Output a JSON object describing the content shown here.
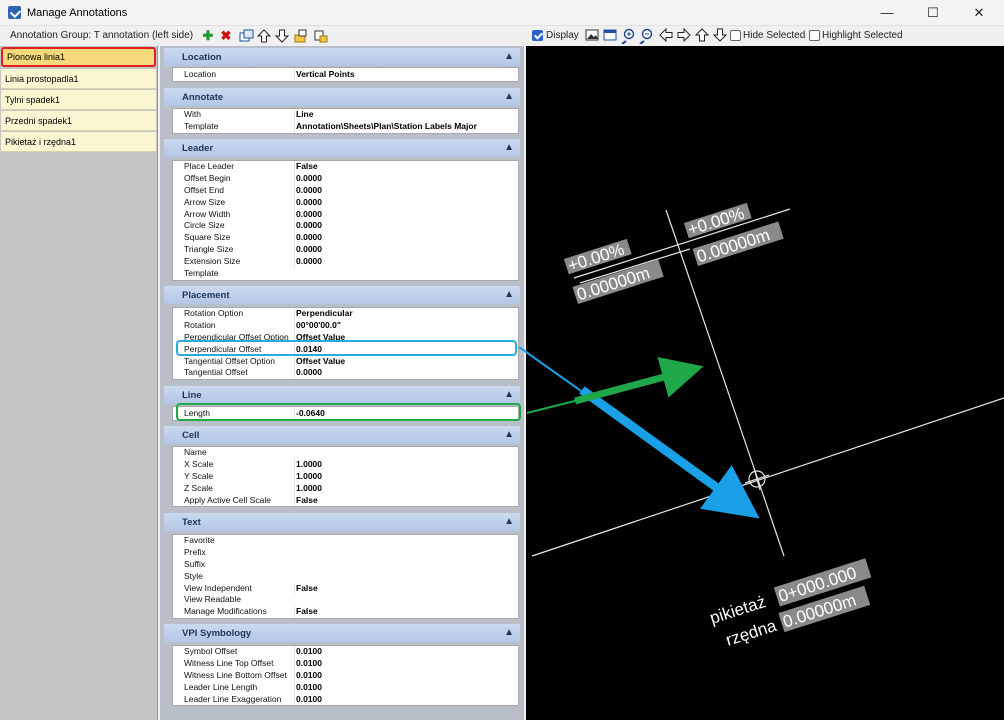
{
  "window": {
    "title": "Manage Annotations",
    "minimize": "—",
    "maximize": "☐",
    "close": "✕"
  },
  "toolbar": {
    "group_label": "Annotation Group: T annotation (left side)",
    "icons": [
      "add-icon",
      "delete-icon",
      "copy-icon",
      "move-up-icon",
      "move-down-icon",
      "import-icon",
      "export-icon"
    ]
  },
  "view_toolbar": {
    "display_label": "Display",
    "display_checked": true,
    "hide_selected_label": "Hide Selected",
    "hide_selected_checked": false,
    "highlight_selected_label": "Highlight Selected",
    "highlight_selected_checked": false
  },
  "annotations": [
    {
      "label": "Pionowa linia1",
      "selected": true
    },
    {
      "label": "Linia prostopadla1",
      "selected": false
    },
    {
      "label": "Tylni spadek1",
      "selected": false
    },
    {
      "label": "Przedni spadek1",
      "selected": false
    },
    {
      "label": "Pikietaż i rzędna1",
      "selected": false
    }
  ],
  "sections": {
    "location": {
      "title": "Location",
      "rows": [
        {
          "k": "Location",
          "v": "Vertical Points"
        }
      ]
    },
    "annotate": {
      "title": "Annotate",
      "rows": [
        {
          "k": "With",
          "v": "Line"
        },
        {
          "k": "Template",
          "v": "Annotation\\Sheets\\Plan\\Station Labels Major"
        }
      ]
    },
    "leader": {
      "title": "Leader",
      "rows": [
        {
          "k": "Place Leader",
          "v": "False"
        },
        {
          "k": "Offset Begin",
          "v": "0.0000"
        },
        {
          "k": "Offset End",
          "v": "0.0000"
        },
        {
          "k": "Arrow Size",
          "v": "0.0000"
        },
        {
          "k": "Arrow Width",
          "v": "0.0000"
        },
        {
          "k": "Circle Size",
          "v": "0.0000"
        },
        {
          "k": "Square Size",
          "v": "0.0000"
        },
        {
          "k": "Triangle Size",
          "v": "0.0000"
        },
        {
          "k": "Extension Size",
          "v": "0.0000"
        },
        {
          "k": "Template",
          "v": ""
        }
      ]
    },
    "placement": {
      "title": "Placement",
      "rows": [
        {
          "k": "Rotation Option",
          "v": "Perpendicular"
        },
        {
          "k": "Rotation",
          "v": "00°00'00.0\""
        },
        {
          "k": "Perpendicular Offset Option",
          "v": "Offset Value"
        },
        {
          "k": "Perpendicular Offset",
          "v": "0.0140"
        },
        {
          "k": "Tangential Offset Option",
          "v": "Offset Value"
        },
        {
          "k": "Tangential Offset",
          "v": "0.0000"
        }
      ]
    },
    "line": {
      "title": "Line",
      "rows": [
        {
          "k": "Length",
          "v": "-0.0640"
        }
      ]
    },
    "cell": {
      "title": "Cell",
      "rows": [
        {
          "k": "Name",
          "v": ""
        },
        {
          "k": "X Scale",
          "v": "1.0000"
        },
        {
          "k": "Y Scale",
          "v": "1.0000"
        },
        {
          "k": "Z Scale",
          "v": "1.0000"
        },
        {
          "k": "Apply Active Cell Scale",
          "v": "False"
        }
      ]
    },
    "text": {
      "title": "Text",
      "rows": [
        {
          "k": "Favorite",
          "v": ""
        },
        {
          "k": "Prefix",
          "v": ""
        },
        {
          "k": "Suffix",
          "v": ""
        },
        {
          "k": "Style",
          "v": ""
        },
        {
          "k": "View Independent",
          "v": "False"
        },
        {
          "k": "View Readable",
          "v": ""
        },
        {
          "k": "Manage Modifications",
          "v": "False"
        }
      ]
    },
    "vpi": {
      "title": "VPI Symbology",
      "rows": [
        {
          "k": "Symbol Offset",
          "v": "0.0100"
        },
        {
          "k": "Witness Line Top Offset",
          "v": "0.0100"
        },
        {
          "k": "Witness Line Bottom Offset",
          "v": "0.0100"
        },
        {
          "k": "Leader Line Length",
          "v": "0.0100"
        },
        {
          "k": "Leader Line Exaggeration",
          "v": "0.0100"
        }
      ]
    }
  },
  "view": {
    "label_left_grade": "+0.00%",
    "label_left_elev": "0.00000m",
    "label_right_grade": "+0.00%",
    "label_right_elev": "0.00000m",
    "station_prefix": "pikietaż",
    "station_value": "0+000.000",
    "elev_prefix": "rzędna",
    "elev_value": "0.00000m"
  },
  "colors": {
    "selected_outline": "#e02020",
    "placement_highlight": "#2aa8e0",
    "line_highlight": "#1fa84a",
    "section_header": "#c3d4ee"
  }
}
